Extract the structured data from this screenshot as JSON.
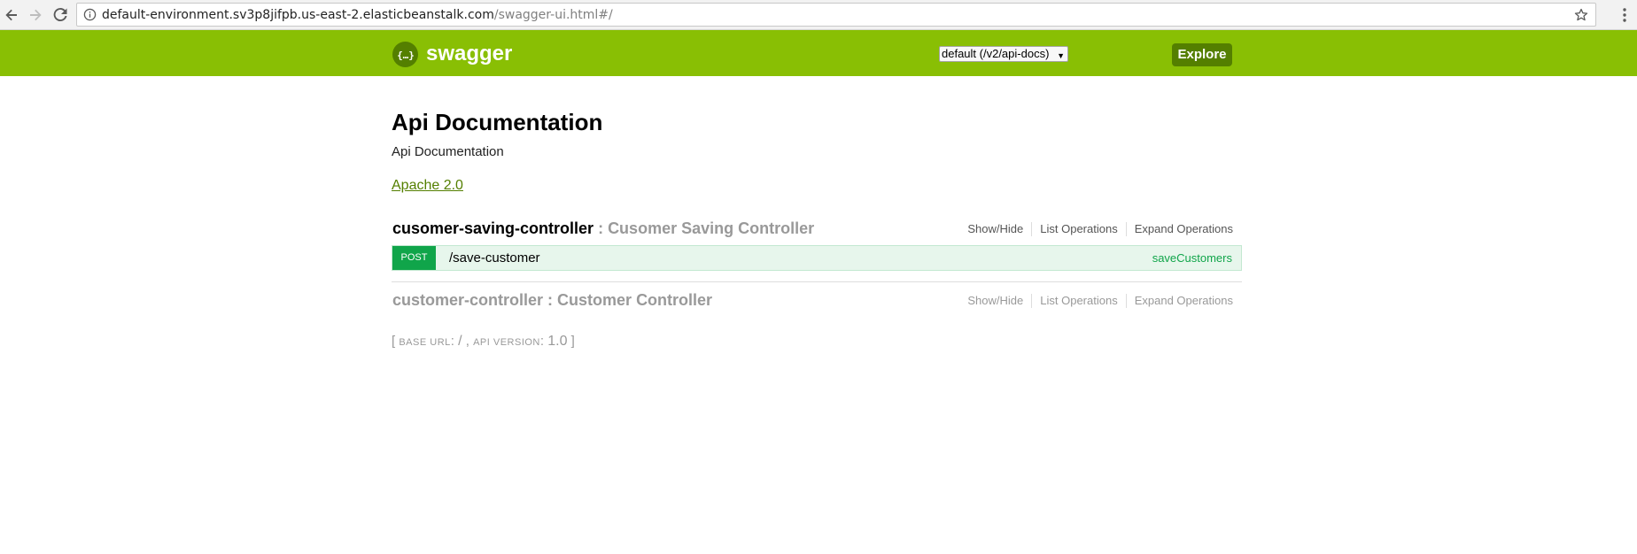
{
  "browser": {
    "url_domain": "default-environment.sv3p8jifpb.us-east-2.elasticbeanstalk.com",
    "url_path": "/swagger-ui.html#/"
  },
  "header": {
    "logo_text": "swagger",
    "logo_mark": "{...}",
    "api_select_value": "default (/v2/api-docs)",
    "explore_label": "Explore",
    "brand_color": "#89bf04",
    "accent_color": "#547f00"
  },
  "info": {
    "title": "Api Documentation",
    "description": "Api Documentation",
    "license": "Apache 2.0"
  },
  "resources": [
    {
      "name": "cusomer-saving-controller",
      "separator": " : ",
      "description": "Cusomer Saving Controller",
      "ops": [
        "Show/Hide",
        "List Operations",
        "Expand Operations"
      ],
      "operation": {
        "method": "POST",
        "path": "/save-customer",
        "nickname": "saveCustomers",
        "method_color": "#10a54a"
      }
    },
    {
      "name": "customer-controller",
      "separator": " : ",
      "description": "Customer Controller",
      "ops": [
        "Show/Hide",
        "List Operations",
        "Expand Operations"
      ]
    }
  ],
  "footer": {
    "open_bracket": "[ ",
    "base_url_label": "BASE URL",
    "base_url_sep": ": ",
    "base_url_value": "/",
    "comma": " , ",
    "api_version_label": "API VERSION",
    "api_version_sep": ": ",
    "api_version_value": "1.0",
    "close_bracket": " ]"
  }
}
